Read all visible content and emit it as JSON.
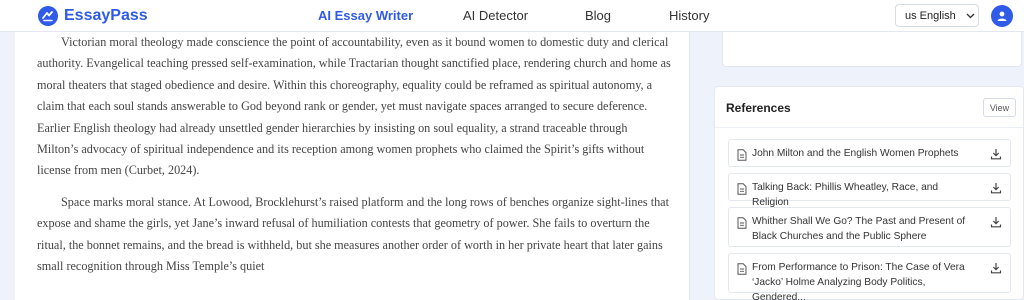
{
  "header": {
    "brand": "EssayPass",
    "nav": [
      {
        "label": "AI Essay Writer",
        "active": true
      },
      {
        "label": "AI Detector",
        "active": false
      },
      {
        "label": "Blog",
        "active": false
      },
      {
        "label": "History",
        "active": false
      }
    ],
    "language": "us English",
    "avatar_icon": "user-icon"
  },
  "essay": {
    "paragraphs": [
      "Victorian moral theology made conscience the point of accountability, even as it bound women to domestic duty and clerical authority. Evangelical teaching pressed self-examination, while Tractarian thought sanctified place, rendering church and home as moral theaters that staged obedience and desire. Within this choreography, equality could be reframed as spiritual autonomy, a claim that each soul stands answerable to God beyond rank or gender, yet must navigate spaces arranged to secure deference. Earlier English theology had already unsettled gender hierarchies by insisting on soul equality, a strand traceable through Milton’s advocacy of spiritual independence and its reception among women prophets who claimed the Spirit’s gifts without license from men (Curbet, 2024).",
      "Space marks moral stance. At Lowood, Brocklehurst’s raised platform and the long rows of benches organize sight-lines that expose and shame the girls, yet Jane’s inward refusal of humiliation contests that geometry of power. She fails to overturn the ritual, the bonnet remains, and the bread is withheld, but she measures another order of worth in her private heart that later gains small recognition through Miss Temple’s quiet"
    ]
  },
  "references": {
    "title": "References",
    "view_label": "View",
    "items": [
      {
        "title": "John Milton and the English Women Prophets"
      },
      {
        "title": "Talking Back: Phillis Wheatley, Race, and Religion"
      },
      {
        "title": "Whither Shall We Go? The Past and Present of Black Churches and the Public Sphere"
      },
      {
        "title": "From Performance to Prison: The Case of Vera ‘Jacko’ Holme Analyzing Body Politics, Gendered..."
      }
    ]
  },
  "colors": {
    "accent": "#2f5be8",
    "background": "#eef2fb"
  }
}
